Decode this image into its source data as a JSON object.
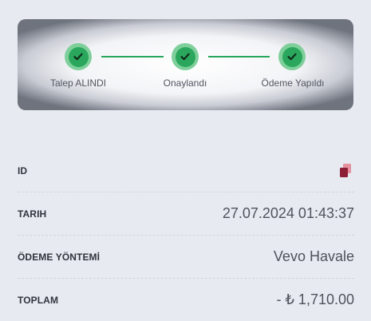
{
  "progress": {
    "steps": [
      {
        "label": "Talep ALINDI",
        "status": "complete"
      },
      {
        "label": "Onaylandı",
        "status": "complete"
      },
      {
        "label": "Ödeme Yapıldı",
        "status": "complete"
      }
    ],
    "accent_color": "#27a65c"
  },
  "details": {
    "id": {
      "label": "ID",
      "icon": "copy-icon"
    },
    "date": {
      "label": "TARIH",
      "value": "27.07.2024 01:43:37"
    },
    "method": {
      "label": "ÖDEME YÖNTEMİ",
      "value": "Vevo Havale"
    },
    "total": {
      "label": "TOPLAM",
      "value": "- ₺ 1,710.00"
    }
  }
}
